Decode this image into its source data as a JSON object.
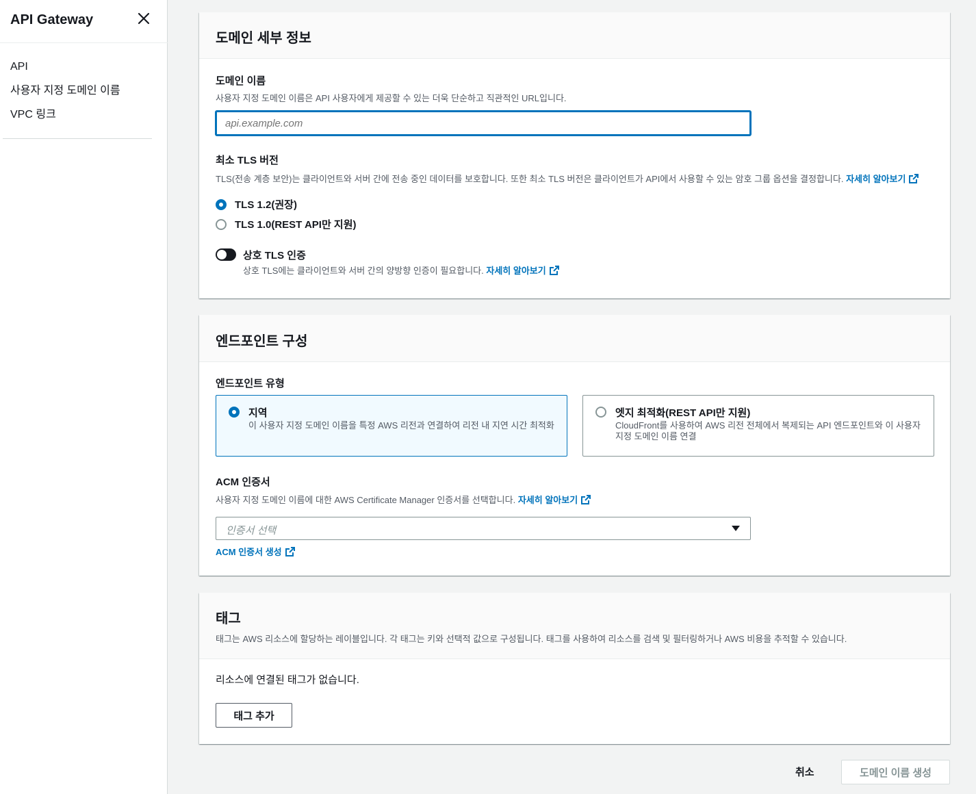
{
  "sidebar": {
    "title": "API Gateway",
    "close_icon": "close-icon",
    "items": [
      {
        "label": "API"
      },
      {
        "label": "사용자 지정 도메인 이름"
      },
      {
        "label": "VPC 링크"
      }
    ]
  },
  "domain_details": {
    "title": "도메인 세부 정보",
    "domain_name": {
      "label": "도메인 이름",
      "description": "사용자 지정 도메인 이름은 API 사용자에게 제공할 수 있는 더욱 단순하고 직관적인 URL입니다.",
      "placeholder": "api.example.com",
      "value": ""
    },
    "tls": {
      "label": "최소 TLS 버전",
      "description": "TLS(전송 계층 보안)는 클라이언트와 서버 간에 전송 중인 데이터를 보호합니다. 또한 최소 TLS 버전은 클라이언트가 API에서 사용할 수 있는 암호 그룹 옵션을 결정합니다.",
      "learn_more": "자세히 알아보기",
      "options": [
        {
          "label": "TLS 1.2(권장)",
          "checked": true
        },
        {
          "label": "TLS 1.0(REST API만 지원)",
          "checked": false
        }
      ]
    },
    "mutual_tls": {
      "label": "상호 TLS 인증",
      "description": "상호 TLS에는 클라이언트와 서버 간의 양방향 인증이 필요합니다.",
      "learn_more": "자세히 알아보기",
      "enabled": false
    }
  },
  "endpoint_config": {
    "title": "엔드포인트 구성",
    "type_label": "엔드포인트 유형",
    "tiles": [
      {
        "title": "지역",
        "description": "이 사용자 지정 도메인 이름을 특정 AWS 리전과 연결하여 리전 내 지연 시간 최적화",
        "selected": true
      },
      {
        "title": "엣지 최적화(REST API만 지원)",
        "description": "CloudFront를 사용하여 AWS 리전 전체에서 복제되는 API 엔드포인트와 이 사용자 지정 도메인 이름 연결",
        "selected": false
      }
    ],
    "acm": {
      "label": "ACM 인증서",
      "description": "사용자 지정 도메인 이름에 대한 AWS Certificate Manager 인증서를 선택합니다.",
      "learn_more": "자세히 알아보기",
      "placeholder": "인증서 선택",
      "create_link": "ACM 인증서 생성"
    }
  },
  "tags": {
    "title": "태그",
    "description": "태그는 AWS 리소스에 할당하는 레이블입니다. 각 태그는 키와 선택적 값으로 구성됩니다. 태그를 사용하여 리소스를 검색 및 필터링하거나 AWS 비용을 추적할 수 있습니다.",
    "empty_text": "리소스에 연결된 태그가 없습니다.",
    "add_button": "태그 추가"
  },
  "footer": {
    "cancel": "취소",
    "submit": "도메인 이름 생성"
  },
  "colors": {
    "link": "#0073bb",
    "text": "#16191f",
    "muted": "#545b64",
    "background": "#f2f3f3"
  }
}
